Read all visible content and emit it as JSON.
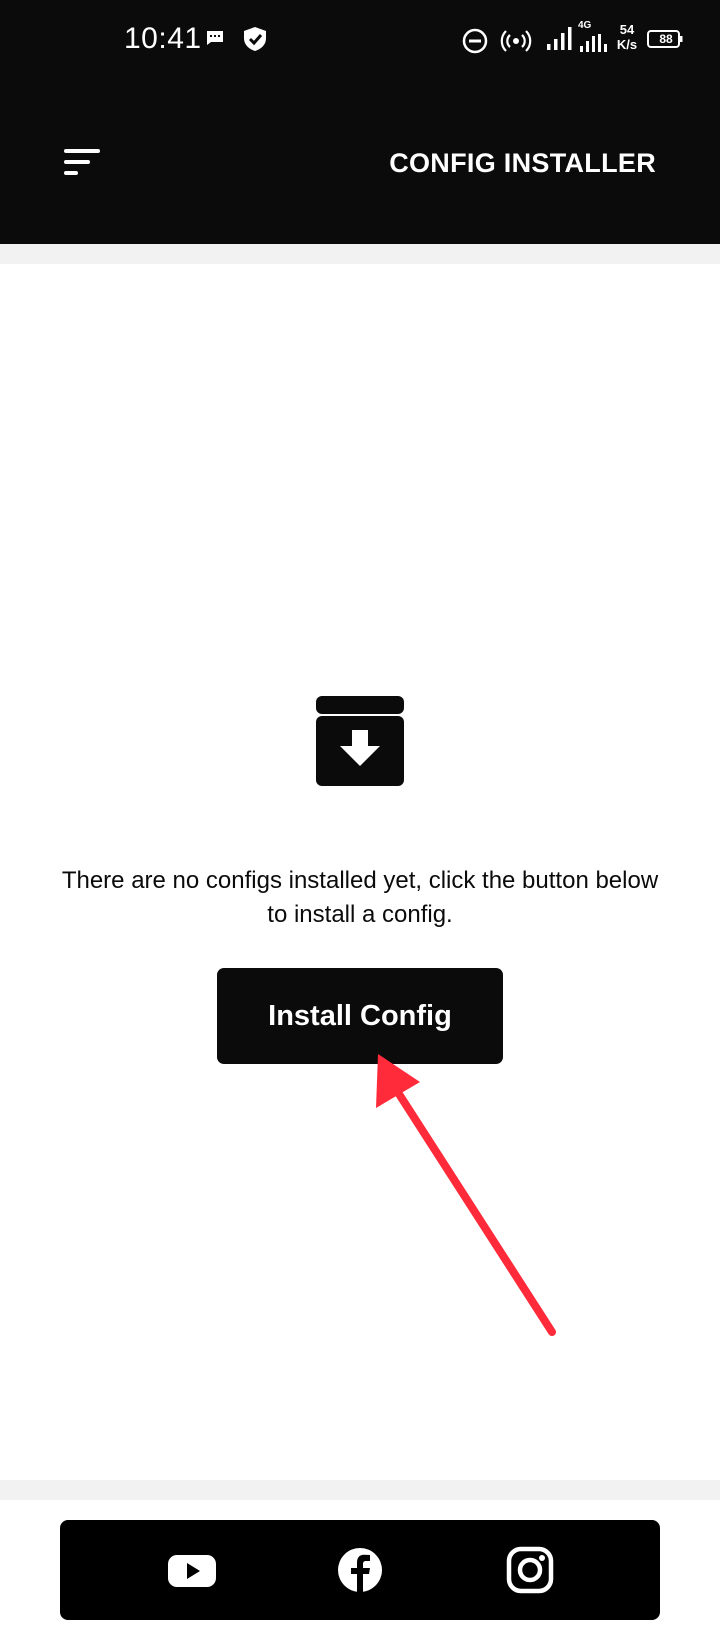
{
  "status_bar": {
    "time": "10:41",
    "network_type": "4G",
    "speed_value": "54",
    "speed_unit": "K/s",
    "battery": "88",
    "icons": [
      "message-icon",
      "shield-check-icon",
      "do-not-disturb-icon",
      "hotspot-icon",
      "signal-icon",
      "signal-4g-icon",
      "battery-icon"
    ]
  },
  "header": {
    "title": "CONFIG INSTALLER",
    "menu_icon": "sort-menu-icon"
  },
  "main": {
    "empty_icon": "archive-download-icon",
    "message": "There are no configs installed yet, click the button below to install a config.",
    "install_button_label": "Install Config",
    "annotation": "red-arrow-pointing-to-install-button"
  },
  "footer": {
    "social_icons": [
      "youtube-icon",
      "facebook-icon",
      "instagram-icon"
    ]
  },
  "colors": {
    "header_bg": "#0b0b0b",
    "button_bg": "#0b0b0b",
    "footer_bg": "#000000",
    "annotation_arrow": "#ff2a3a",
    "strip_gray": "#f2f2f2"
  }
}
